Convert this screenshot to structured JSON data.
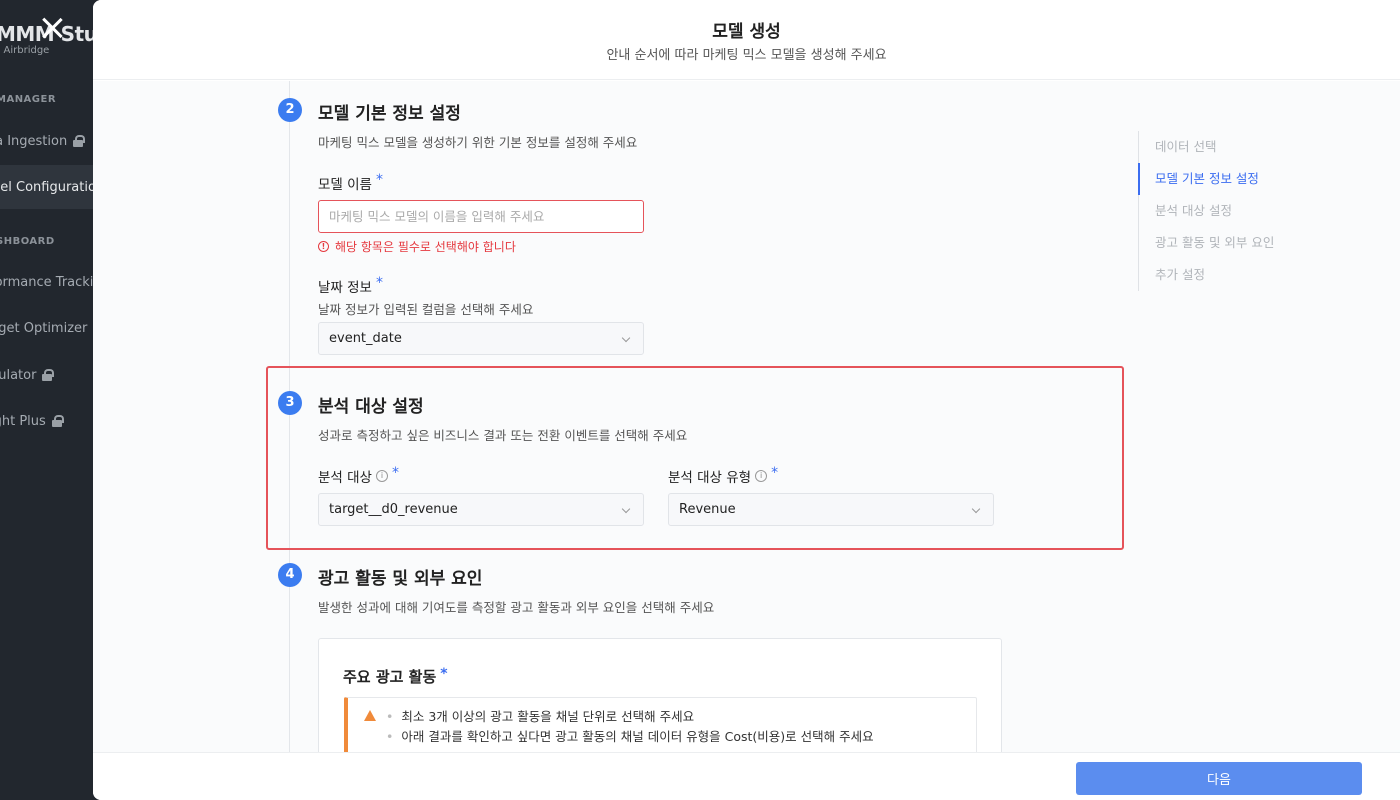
{
  "background": {
    "logo": "MMM Studio",
    "logo_sub": "n Airbridge",
    "sections": [
      "MANAGER",
      "SHBOARD"
    ],
    "items": [
      {
        "label": "ta Ingestion",
        "locked": true
      },
      {
        "label": "del Configuration",
        "locked": false,
        "active": true
      },
      {
        "label": "formance Tracking",
        "locked": false
      },
      {
        "label": "dget Optimizer",
        "locked": false
      },
      {
        "label": "nulator",
        "locked": true
      },
      {
        "label": "ight Plus",
        "locked": true
      }
    ]
  },
  "modal": {
    "title": "모델 생성",
    "subtitle": "안내 순서에 따라 마케팅 믹스 모델을 생성해 주세요",
    "next_label": "다음"
  },
  "step2": {
    "number": "2",
    "title": "모델 기본 정보 설정",
    "desc": "마케팅 믹스 모델을 생성하기 위한 기본 정보를 설정해 주세요",
    "model_name_label": "모델 이름",
    "model_name_placeholder": "마케팅 믹스 모델의 이름을 입력해 주세요",
    "model_name_value": "",
    "error": "해당 항목은 필수로 선택해야 합니다",
    "date_label": "날짜 정보",
    "date_desc": "날짜 정보가 입력된 컬럼을 선택해 주세요",
    "date_value": "event_date"
  },
  "step3": {
    "number": "3",
    "title": "분석 대상 설정",
    "desc": "성과로 측정하고 싶은 비즈니스 결과 또는 전환 이벤트를 선택해 주세요",
    "target_label": "분석 대상",
    "target_value": "target__d0_revenue",
    "type_label": "분석 대상 유형",
    "type_value": "Revenue"
  },
  "step4": {
    "number": "4",
    "title": "광고 활동 및 외부 요인",
    "desc": "발생한 성과에 대해 기여도를 측정할 광고 활동과 외부 요인을 선택해 주세요",
    "card_title": "주요 광고 활동",
    "warnings": [
      "최소 3개 이상의 광고 활동을 채널 단위로 선택해 주세요",
      "아래 결과를 확인하고 싶다면 광고 활동의 채널 데이터 유형을 Cost(비용)로 선택해 주세요"
    ]
  },
  "required_mark": "*",
  "info_mark": "i",
  "error_mark": "!",
  "step_nav": [
    {
      "label": "데이터 선택",
      "active": false
    },
    {
      "label": "모델 기본 정보 설정",
      "active": true
    },
    {
      "label": "분석 대상 설정",
      "active": false
    },
    {
      "label": "광고 활동 및 외부 요인",
      "active": false
    },
    {
      "label": "추가 설정",
      "active": false
    }
  ],
  "colors": {
    "accent": "#3b7cf0",
    "error": "#e5393f",
    "warning": "#f08a3a",
    "primary_button": "#5b8def"
  }
}
